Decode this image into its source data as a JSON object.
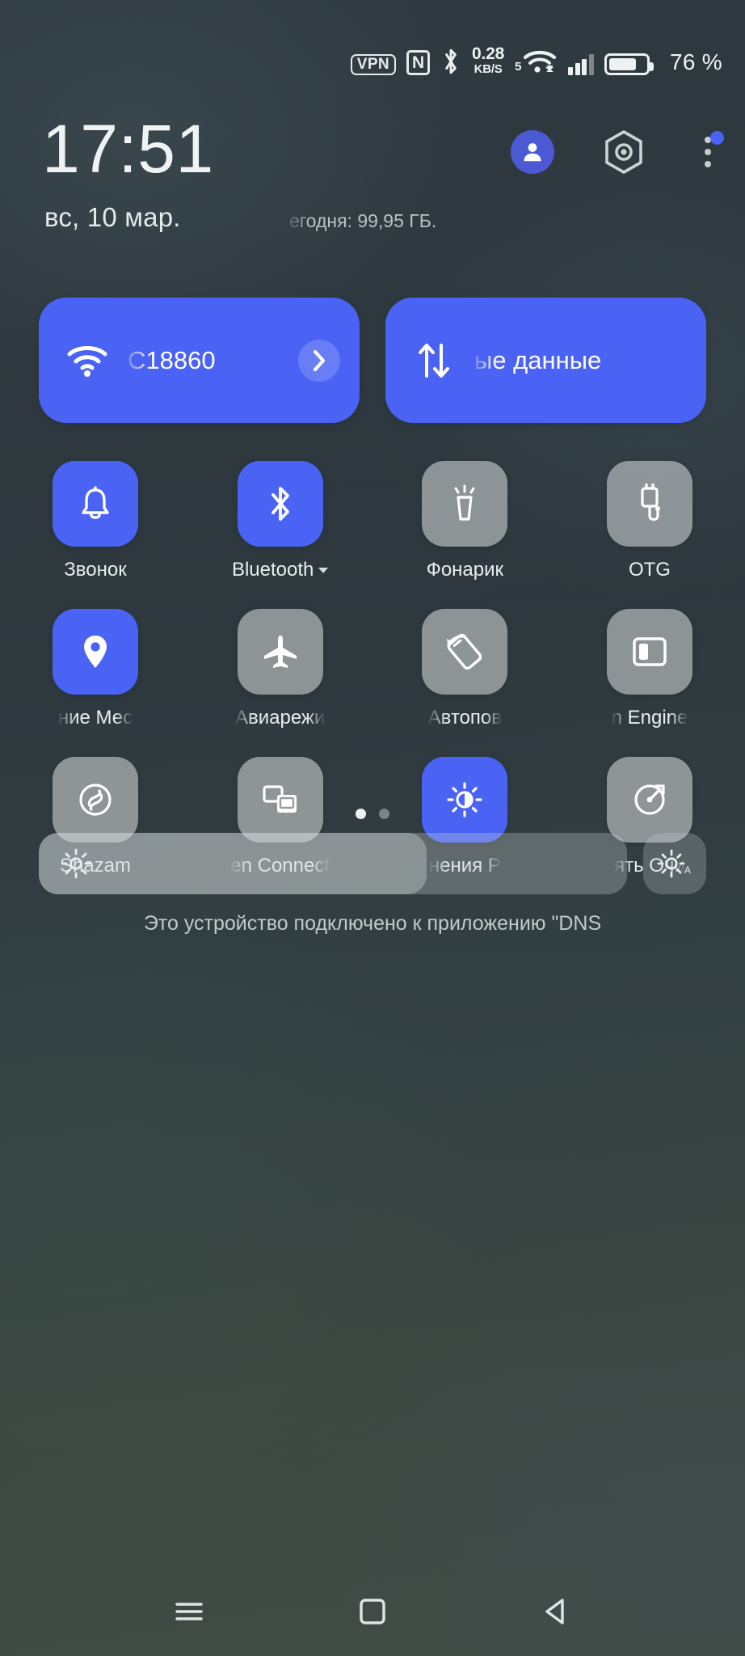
{
  "status_bar": {
    "vpn_label": "VPN",
    "nfc_label": "N",
    "net_speed_value": "0.28",
    "net_speed_unit": "KB/S",
    "wifi_band": "5",
    "battery_percent_label": "76 %",
    "battery_level": 76,
    "icons": [
      "vpn-badge",
      "nfc-icon",
      "bluetooth-icon",
      "network-speed",
      "wifi-icon",
      "cellular-signal-icon",
      "battery-icon"
    ]
  },
  "header": {
    "clock": "17:51",
    "date": "вс, 10 мар.",
    "data_usage": "егодня: 99,95 ГБ.",
    "avatar_icon": "user-avatar-icon",
    "settings_icon": "settings-hexagon-icon",
    "overflow_icon": "three-dot-menu-icon",
    "overflow_badge": true
  },
  "connectivity": [
    {
      "name": "wifi",
      "icon": "wifi-icon",
      "label": "C18860",
      "active": true,
      "has_chevron": true
    },
    {
      "name": "mobile-data",
      "icon": "data-transfer-icon",
      "label": "ые данные",
      "active": true,
      "has_chevron": false
    }
  ],
  "toggles": [
    [
      {
        "name": "ringer",
        "icon": "bell-icon",
        "label": "Звонок",
        "active": true,
        "caret": false,
        "clipped": false
      },
      {
        "name": "bluetooth",
        "icon": "bluetooth-icon",
        "label": "Bluetooth",
        "active": true,
        "caret": true,
        "clipped": false
      },
      {
        "name": "flashlight",
        "icon": "flashlight-icon",
        "label": "Фонарик",
        "active": false,
        "caret": false,
        "clipped": false
      },
      {
        "name": "otg",
        "icon": "usb-otg-icon",
        "label": "OTG",
        "active": false,
        "caret": false,
        "clipped": false
      }
    ],
    [
      {
        "name": "location",
        "icon": "location-pin-icon",
        "label": "ние    Мес",
        "active": true,
        "caret": false,
        "clipped": true
      },
      {
        "name": "airplane-mode",
        "icon": "airplane-icon",
        "label": "Авиарежи",
        "active": false,
        "caret": false,
        "clipped": true
      },
      {
        "name": "auto-rotate",
        "icon": "rotate-screen-icon",
        "label": "Автопов",
        "active": false,
        "caret": false,
        "clipped": true
      },
      {
        "name": "game-engine",
        "icon": "split-screen-icon",
        "label": "n Engine",
        "active": false,
        "caret": false,
        "clipped": true
      }
    ],
    [
      {
        "name": "shazam",
        "icon": "shazam-icon",
        "label": "Shazam",
        "active": false,
        "caret": false,
        "clipped": false
      },
      {
        "name": "screen-cast",
        "icon": "screen-cast-icon",
        "label": "en Connect",
        "active": false,
        "caret": false,
        "clipped": true
      },
      {
        "name": "brightness",
        "icon": "brightness-icon",
        "label": "нения     Р",
        "active": true,
        "caret": false,
        "clipped": true
      },
      {
        "name": "cleaner",
        "icon": "cleaner-icon",
        "label": "ять    Очи",
        "active": false,
        "caret": false,
        "clipped": true
      }
    ]
  ],
  "pager": {
    "pages": 2,
    "active_index": 0
  },
  "brightness": {
    "icon": "brightness-sun-icon",
    "auto_icon": "brightness-auto-icon",
    "auto_label": "A",
    "value_percent": 66
  },
  "footer_note": "Это устройство подключено к приложению \"DNS",
  "navbar": [
    {
      "name": "recents-button",
      "icon": "hamburger-icon"
    },
    {
      "name": "home-button",
      "icon": "square-icon"
    },
    {
      "name": "back-button",
      "icon": "triangle-back-icon"
    }
  ],
  "colors": {
    "accent_blue": "#4a63f5",
    "avatar_blue": "#4b5ad4",
    "tile_off": "rgba(215,219,219,0.56)",
    "text_primary": "#f0f3f4",
    "text_secondary": "#c2caca"
  }
}
